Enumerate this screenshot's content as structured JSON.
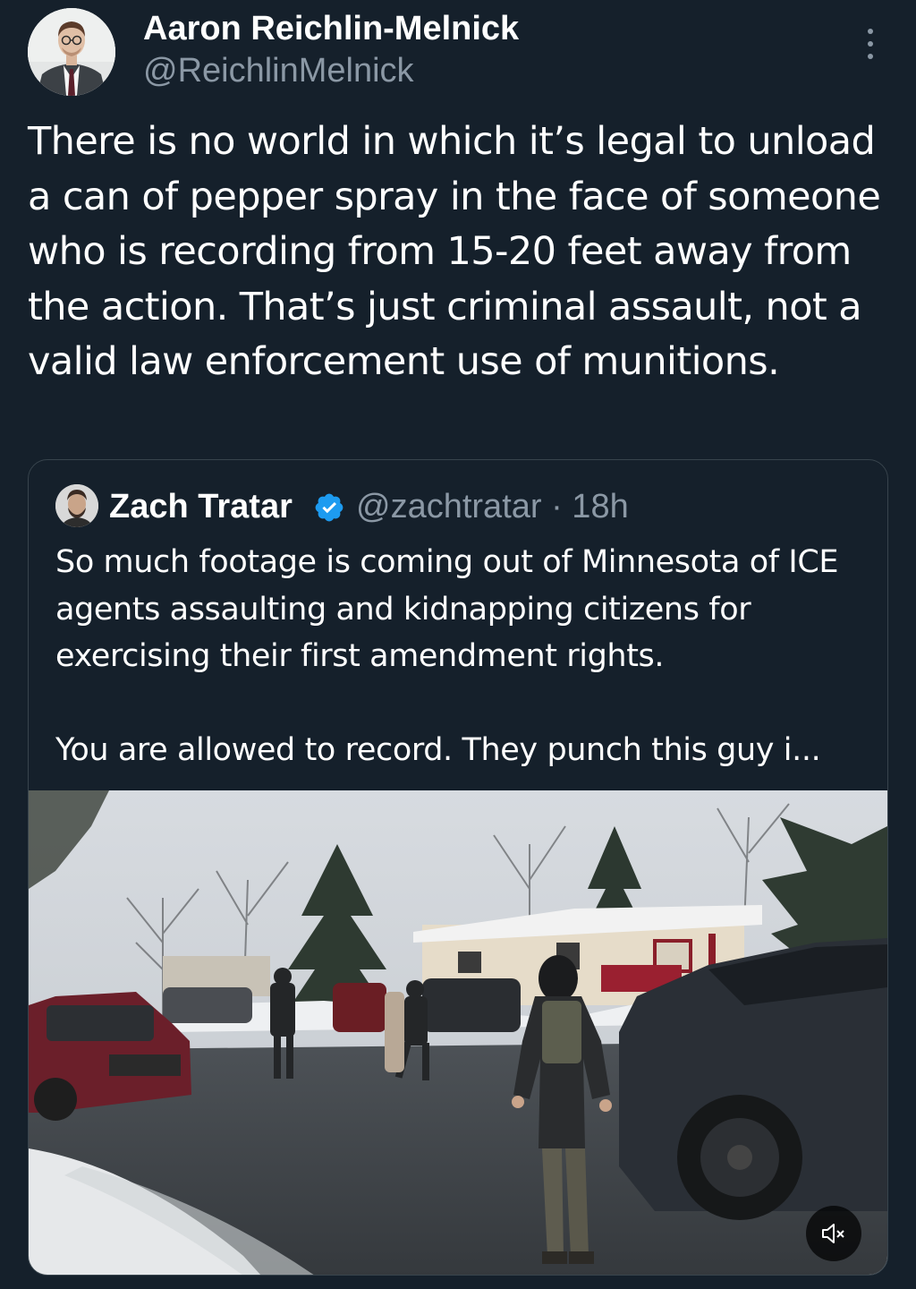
{
  "tweet": {
    "author_name": "Aaron Reichlin-Melnick",
    "author_handle": "@ReichlinMelnick",
    "text": "There is no world in which it’s legal to unload a can of pepper spray in the face of someone who is recording from 15-20 feet away from the action. That’s just criminal assault, not a valid law enforcement use of munitions."
  },
  "quoted_tweet": {
    "author_name": "Zach Tratar",
    "verified": true,
    "meta": "@zachtratar · 18h",
    "paragraph_1": "So much footage is coming out of Minnesota of ICE agents assaulting and kidnapping citizens for exercising their first amendment rights.",
    "paragraph_2": "You are allowed to record. They punch this guy i..."
  },
  "media": {
    "type": "video",
    "muted": true
  },
  "icons": {
    "more": "more-vertical-icon",
    "verified": "verified-badge-icon",
    "mute": "speaker-muted-icon"
  },
  "colors": {
    "background": "#15202b",
    "secondary_text": "#8b98a5",
    "border": "#38444d",
    "verified_blue": "#1d9bf0"
  }
}
